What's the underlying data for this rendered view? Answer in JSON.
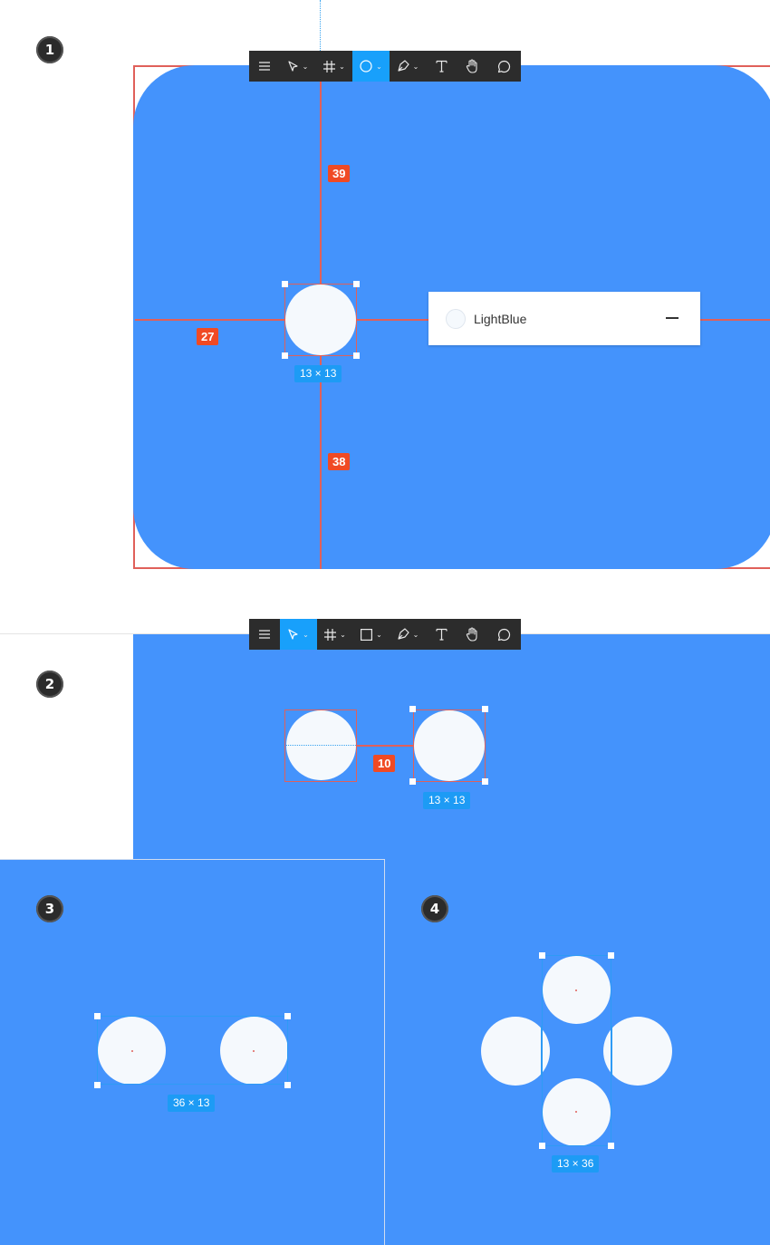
{
  "steps": [
    "1",
    "2",
    "3",
    "4"
  ],
  "colors": {
    "canvas_blue": "#4493fc",
    "circle_fill": "#f5f9fd",
    "measure_red": "#f04a24",
    "selection_blue": "#1d9bf5",
    "toolbar_bg": "#2c2c2c",
    "toolbar_active": "#18a0fb"
  },
  "toolbar_tools": [
    {
      "icon": "menu-icon"
    },
    {
      "icon": "move-tool-icon",
      "has_dropdown": true
    },
    {
      "icon": "frame-tool-icon",
      "has_dropdown": true
    },
    {
      "icon": "shape-tool-icon",
      "has_dropdown": true
    },
    {
      "icon": "pen-tool-icon",
      "has_dropdown": true
    },
    {
      "icon": "text-tool-icon"
    },
    {
      "icon": "hand-tool-icon"
    },
    {
      "icon": "comment-tool-icon"
    }
  ],
  "panel1": {
    "active_tool": "ellipse-tool-icon",
    "distance_top": "39",
    "distance_left": "27",
    "distance_bottom": "38",
    "size_label": "13 × 13",
    "style_popup": {
      "name": "LightBlue"
    }
  },
  "panel2": {
    "active_tool": "move-tool-icon",
    "distance_between": "10",
    "size_label": "13 × 13"
  },
  "panel3": {
    "size_label": "36 × 13"
  },
  "panel4": {
    "size_label": "13 × 36"
  }
}
